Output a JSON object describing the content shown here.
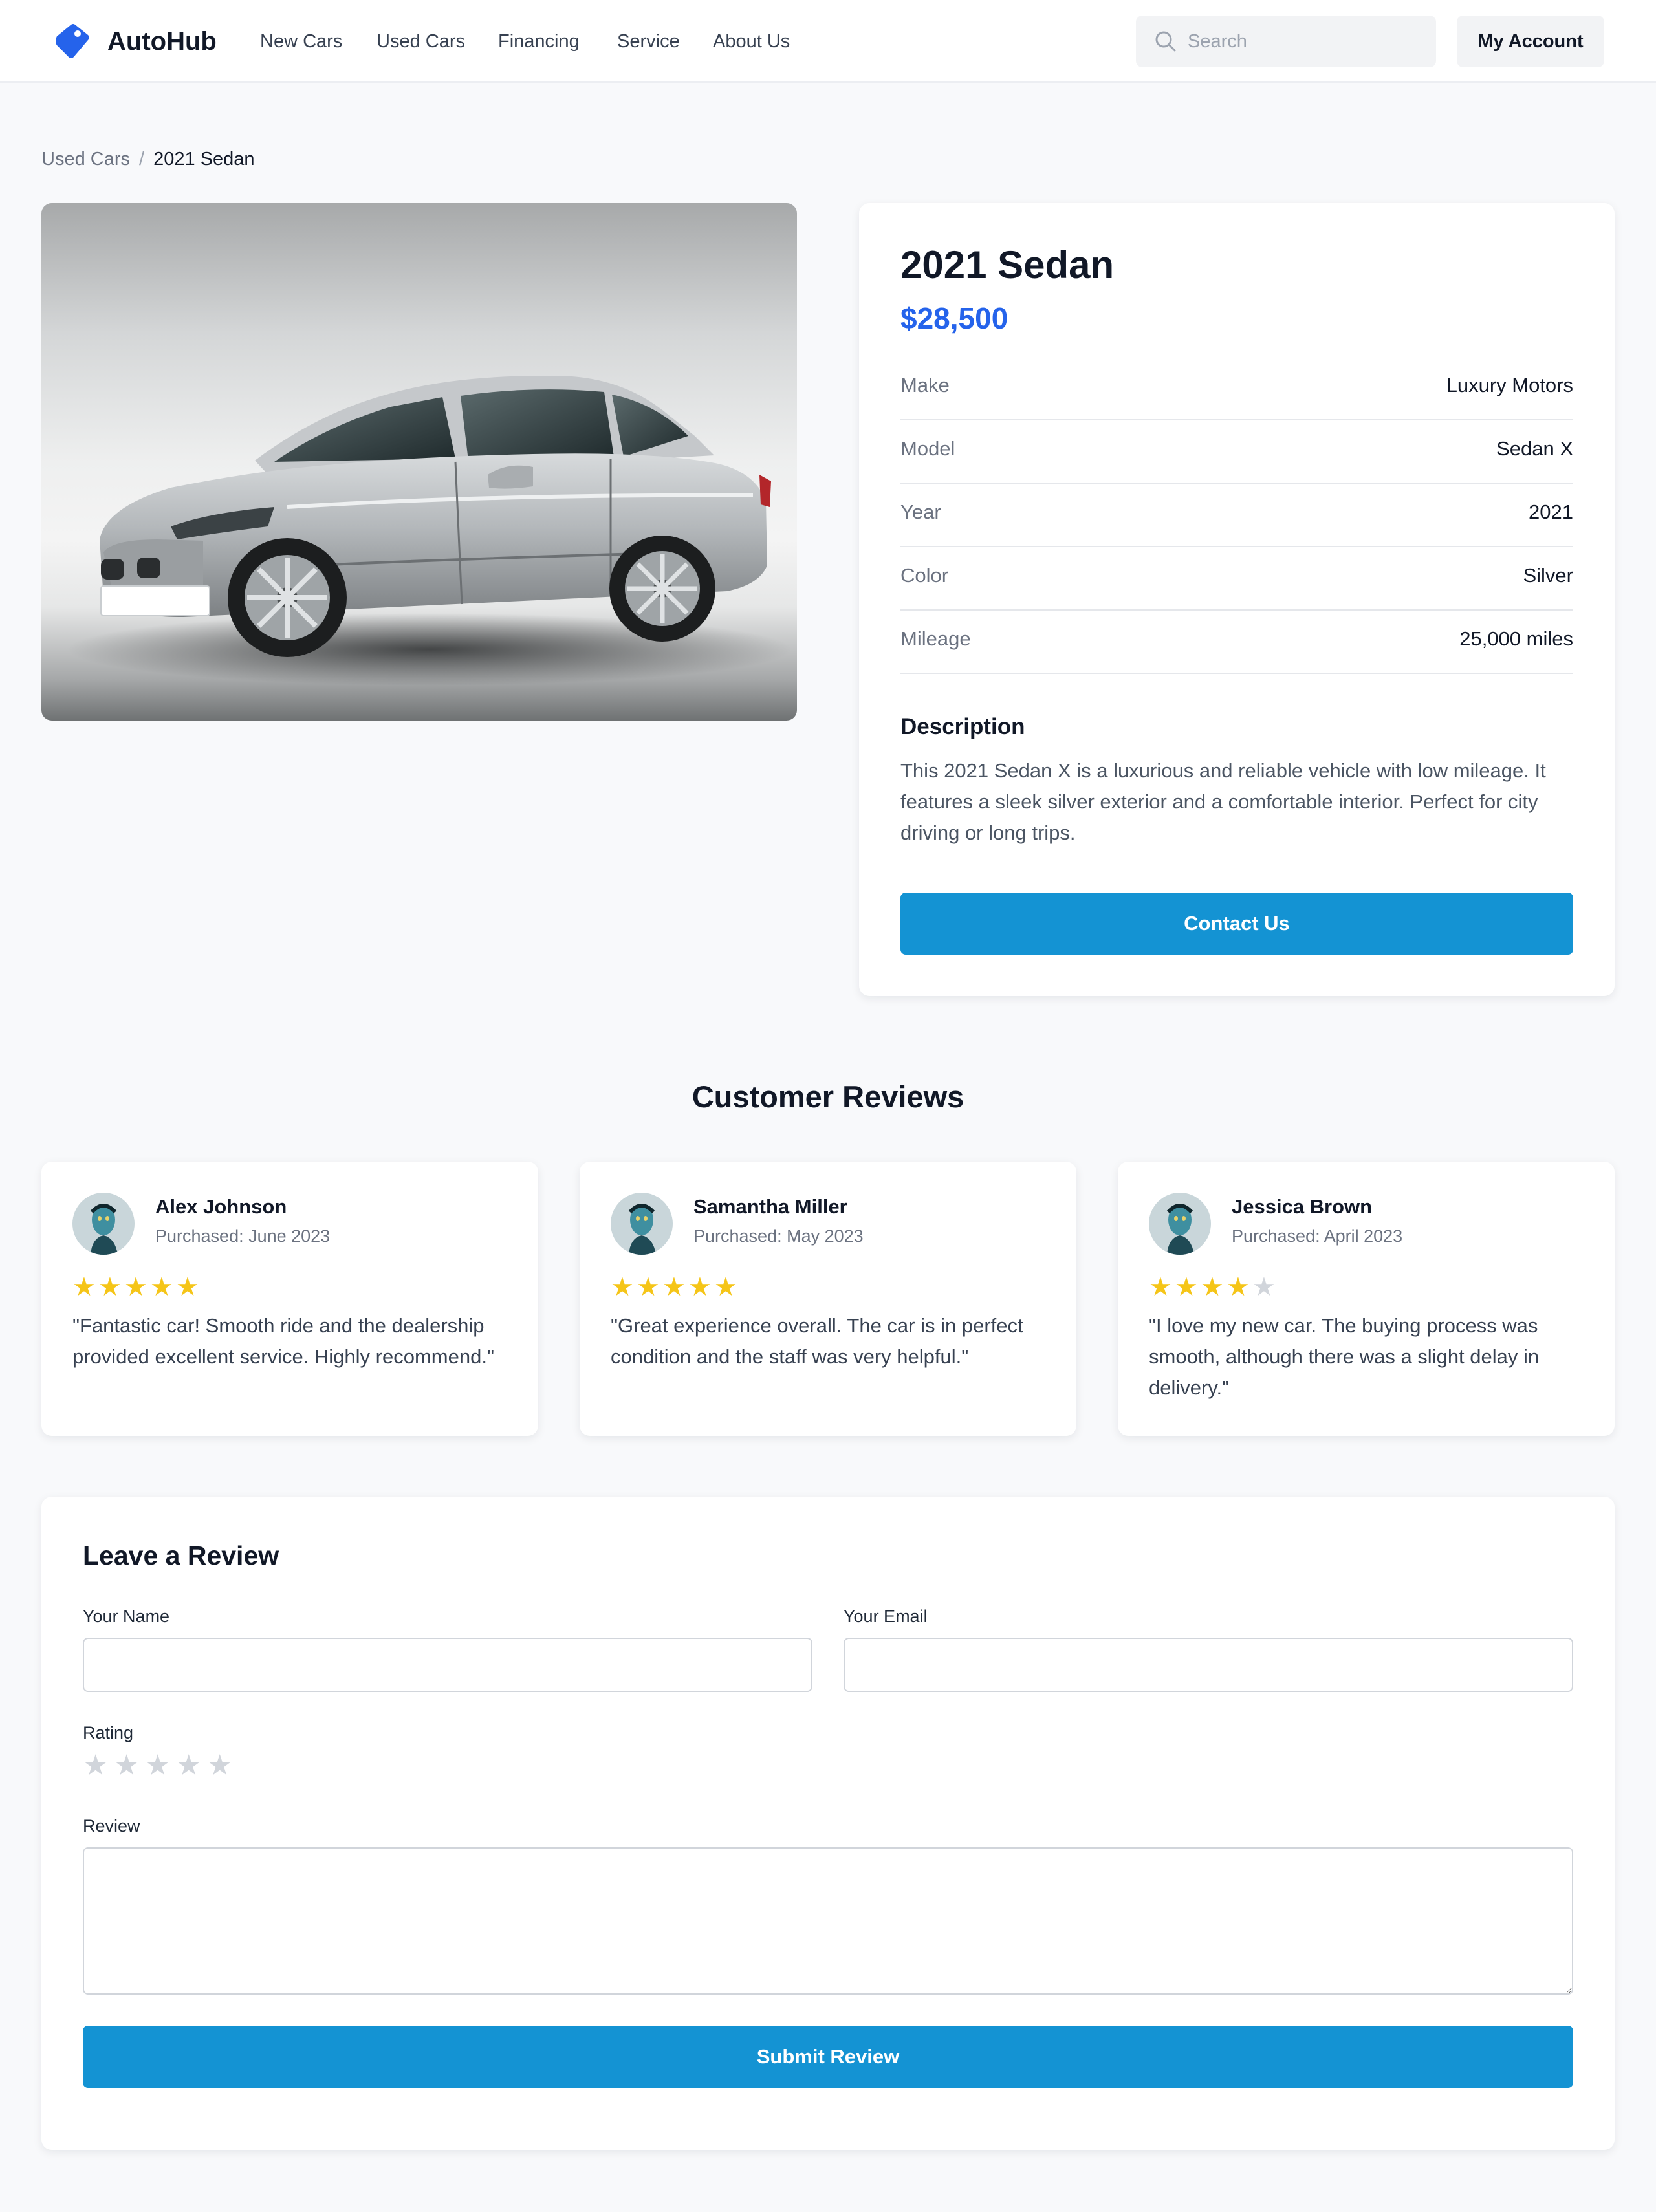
{
  "header": {
    "brand": "AutoHub",
    "nav": [
      "New Cars",
      "Used Cars",
      "Financing",
      "Service",
      "About Us"
    ],
    "search_placeholder": "Search",
    "account_label": "My Account"
  },
  "breadcrumb": {
    "parent": "Used Cars",
    "separator": "/",
    "current": "2021 Sedan"
  },
  "car": {
    "title": "2021 Sedan",
    "price": "$28,500",
    "specs": [
      {
        "label": "Make",
        "value": "Luxury Motors"
      },
      {
        "label": "Model",
        "value": "Sedan X"
      },
      {
        "label": "Year",
        "value": "2021"
      },
      {
        "label": "Color",
        "value": "Silver"
      },
      {
        "label": "Mileage",
        "value": "25,000 miles"
      }
    ],
    "description_heading": "Description",
    "description": "This 2021 Sedan X is a luxurious and reliable vehicle with low mileage. It features a sleek silver exterior and a comfortable interior. Perfect for city driving or long trips.",
    "contact_label": "Contact Us",
    "plate_text": ""
  },
  "reviews": {
    "title": "Customer Reviews",
    "items": [
      {
        "name": "Alex Johnson",
        "purchased": "Purchased: June 2023",
        "rating": 5,
        "text": "\"Fantastic car! Smooth ride and the dealership provided excellent service. Highly recommend.\""
      },
      {
        "name": "Samantha Miller",
        "purchased": "Purchased: May 2023",
        "rating": 5,
        "text": "\"Great experience overall. The car is in perfect condition and the staff was very helpful.\""
      },
      {
        "name": "Jessica Brown",
        "purchased": "Purchased: April 2023",
        "rating": 4,
        "text": "\"I love my new car. The buying process was smooth, although there was a slight delay in delivery.\""
      }
    ]
  },
  "review_form": {
    "title": "Leave a Review",
    "name_label": "Your Name",
    "name_value": "",
    "email_label": "Your Email",
    "email_value": "",
    "rating_label": "Rating",
    "rating_value": 0,
    "review_label": "Review",
    "review_value": "",
    "submit_label": "Submit Review"
  },
  "colors": {
    "brand_blue": "#2563eb",
    "button_blue": "#1493d3",
    "star_filled": "#f5c518",
    "star_empty": "#d1d5db"
  },
  "icons": {
    "logo": "tag-logo-icon",
    "search": "search-icon",
    "star": "star-icon",
    "avatar": "avatar-icon"
  }
}
